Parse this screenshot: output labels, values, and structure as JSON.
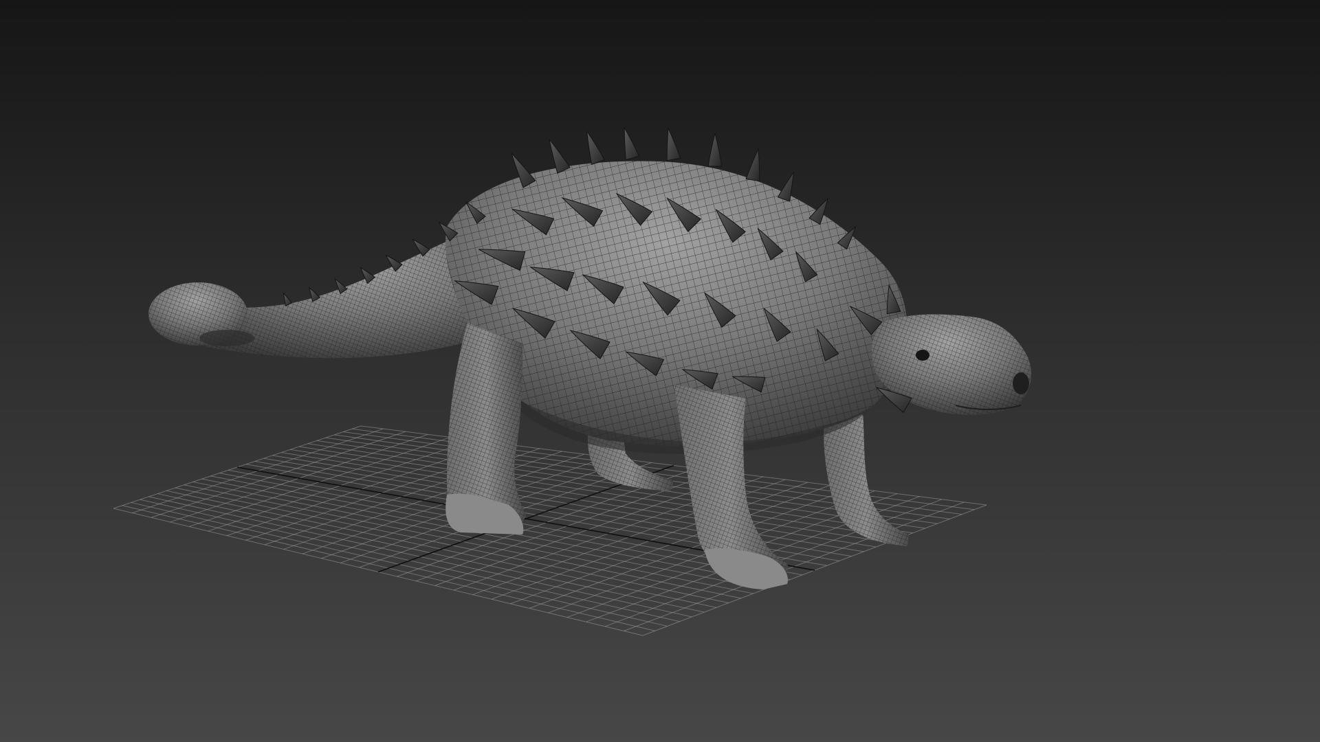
{
  "viewport": {
    "background_top": "#161616",
    "background_mid": "#2e2e2e",
    "background_bottom": "#474747",
    "grid_color": "#9a9a9a",
    "grid_axis_color": "#0e0e0e"
  },
  "model": {
    "display_mode": "shaded-wireframe",
    "body_highlight": "#a2a2a2",
    "body_mid": "#7a7a7a",
    "body_shadow": "#3c3c3c",
    "spike_dark": "#262626",
    "spike_light": "#5c5c5c",
    "wire_color": "#1a1a1a"
  }
}
